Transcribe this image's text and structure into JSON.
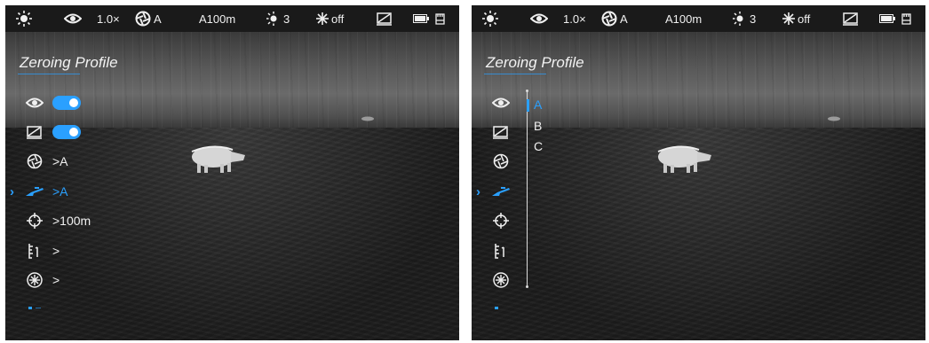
{
  "status_bar": {
    "zoom": "1.0×",
    "palette": "A",
    "profile_distance": "A100m",
    "brightness": "3",
    "mode": "off"
  },
  "left_panel": {
    "title": "Zeroing Profile",
    "menu": [
      {
        "icon": "eye-icon",
        "value": "",
        "toggle": true
      },
      {
        "icon": "pip-icon",
        "value": "",
        "toggle": true
      },
      {
        "icon": "aperture-icon",
        "value": ">A"
      },
      {
        "icon": "rifle-icon",
        "value": ">A",
        "active": true
      },
      {
        "icon": "crosshair-icon",
        "value": ">100m"
      },
      {
        "icon": "ruler-icon",
        "value": ">"
      },
      {
        "icon": "snowflake-icon",
        "value": ">"
      }
    ]
  },
  "right_panel": {
    "title": "Zeroing Profile",
    "submenu": [
      "A",
      "B",
      "C"
    ],
    "submenu_selected": "A"
  },
  "colors": {
    "accent": "#2aa0ff",
    "statusbar": "#1a1a1a"
  }
}
